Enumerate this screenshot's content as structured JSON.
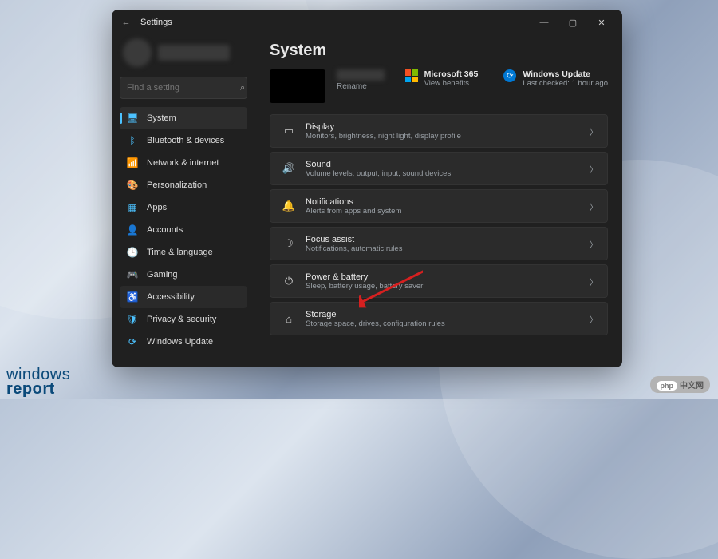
{
  "titlebar": {
    "back": "←",
    "title": "Settings"
  },
  "search": {
    "placeholder": "Find a setting"
  },
  "sidebar": {
    "items": [
      {
        "icon": "🖥",
        "label": "System",
        "active": true,
        "iconClass": "ic-blue"
      },
      {
        "icon": "ᛒ",
        "label": "Bluetooth & devices",
        "iconClass": "ic-blue"
      },
      {
        "icon": "📶",
        "label": "Network & internet"
      },
      {
        "icon": "🎨",
        "label": "Personalization"
      },
      {
        "icon": "▦",
        "label": "Apps",
        "iconClass": "ic-blue"
      },
      {
        "icon": "👤",
        "label": "Accounts"
      },
      {
        "icon": "🕒",
        "label": "Time & language",
        "iconClass": "ic-yellow"
      },
      {
        "icon": "🎮",
        "label": "Gaming"
      },
      {
        "icon": "♿",
        "label": "Accessibility",
        "hover": true,
        "iconClass": "ic-blue"
      },
      {
        "icon": "🛡",
        "label": "Privacy & security",
        "iconClass": "ic-blue"
      },
      {
        "icon": "⟳",
        "label": "Windows Update",
        "iconClass": "ic-blue"
      }
    ]
  },
  "main": {
    "heading": "System",
    "rename": "Rename",
    "ms365": {
      "title": "Microsoft 365",
      "sub": "View benefits"
    },
    "wu": {
      "title": "Windows Update",
      "sub": "Last checked: 1 hour ago"
    },
    "cards": [
      {
        "icon": "▭",
        "title": "Display",
        "sub": "Monitors, brightness, night light, display profile"
      },
      {
        "icon": "🔊",
        "title": "Sound",
        "sub": "Volume levels, output, input, sound devices"
      },
      {
        "icon": "🔔",
        "title": "Notifications",
        "sub": "Alerts from apps and system"
      },
      {
        "icon": "☽",
        "title": "Focus assist",
        "sub": "Notifications, automatic rules"
      },
      {
        "icon": "⏻",
        "title": "Power & battery",
        "sub": "Sleep, battery usage, battery saver"
      },
      {
        "icon": "⌂",
        "title": "Storage",
        "sub": "Storage space, drives, configuration rules"
      }
    ]
  },
  "watermarks": {
    "left1": "windows",
    "left2": "report",
    "right": "中文网"
  }
}
